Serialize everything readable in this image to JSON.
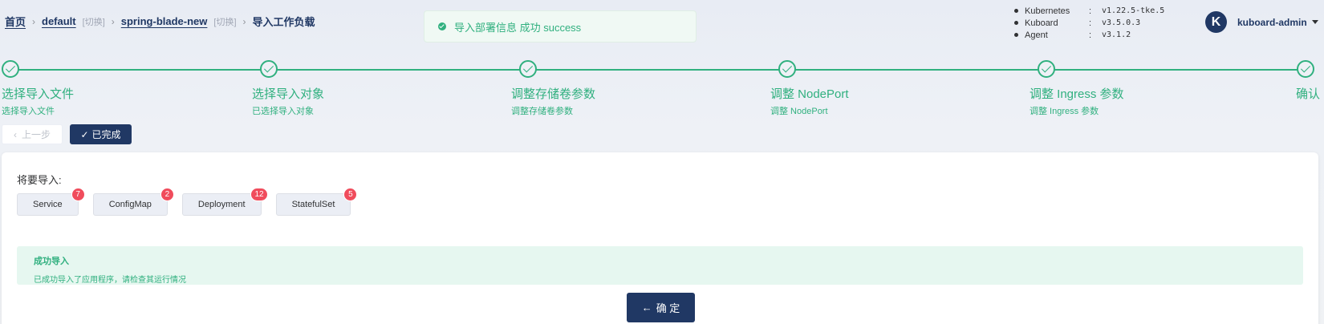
{
  "breadcrumb": {
    "home": "首页",
    "namespace": "default",
    "namespace_switch": "[切换]",
    "cluster": "spring-blade-new",
    "cluster_switch": "[切换]",
    "current": "导入工作负载"
  },
  "toast": {
    "message": "导入部署信息 成功 success"
  },
  "versions": [
    {
      "name": "Kubernetes",
      "colon": ":",
      "value": "v1.22.5-tke.5"
    },
    {
      "name": "Kuboard",
      "colon": ":",
      "value": "v3.5.0.3"
    },
    {
      "name": "Agent",
      "colon": ":",
      "value": "v3.1.2"
    }
  ],
  "user": {
    "avatar_letter": "K",
    "name": "kuboard-admin"
  },
  "steps": [
    {
      "title": "选择导入文件",
      "desc": "选择导入文件"
    },
    {
      "title": "选择导入对象",
      "desc": "已选择导入对象"
    },
    {
      "title": "调整存储卷参数",
      "desc": "调整存储卷参数"
    },
    {
      "title": "调整 NodePort",
      "desc": "调整 NodePort"
    },
    {
      "title": "调整 Ingress 参数",
      "desc": "调整 Ingress 参数"
    },
    {
      "title": "确认",
      "desc": ""
    }
  ],
  "nav": {
    "prev_label": "上一步",
    "done_label": "已完成"
  },
  "import": {
    "label": "将要导入:",
    "tags": [
      {
        "name": "Service",
        "count": "7"
      },
      {
        "name": "ConfigMap",
        "count": "2"
      },
      {
        "name": "Deployment",
        "count": "12"
      },
      {
        "name": "StatefulSet",
        "count": "5"
      }
    ]
  },
  "alert": {
    "title": "成功导入",
    "desc": "已成功导入了应用程序，请检查其运行情况"
  },
  "confirm_label": "确 定",
  "colors": {
    "primary": "#203864",
    "success": "#30b07f",
    "badge": "#f04c5c"
  }
}
